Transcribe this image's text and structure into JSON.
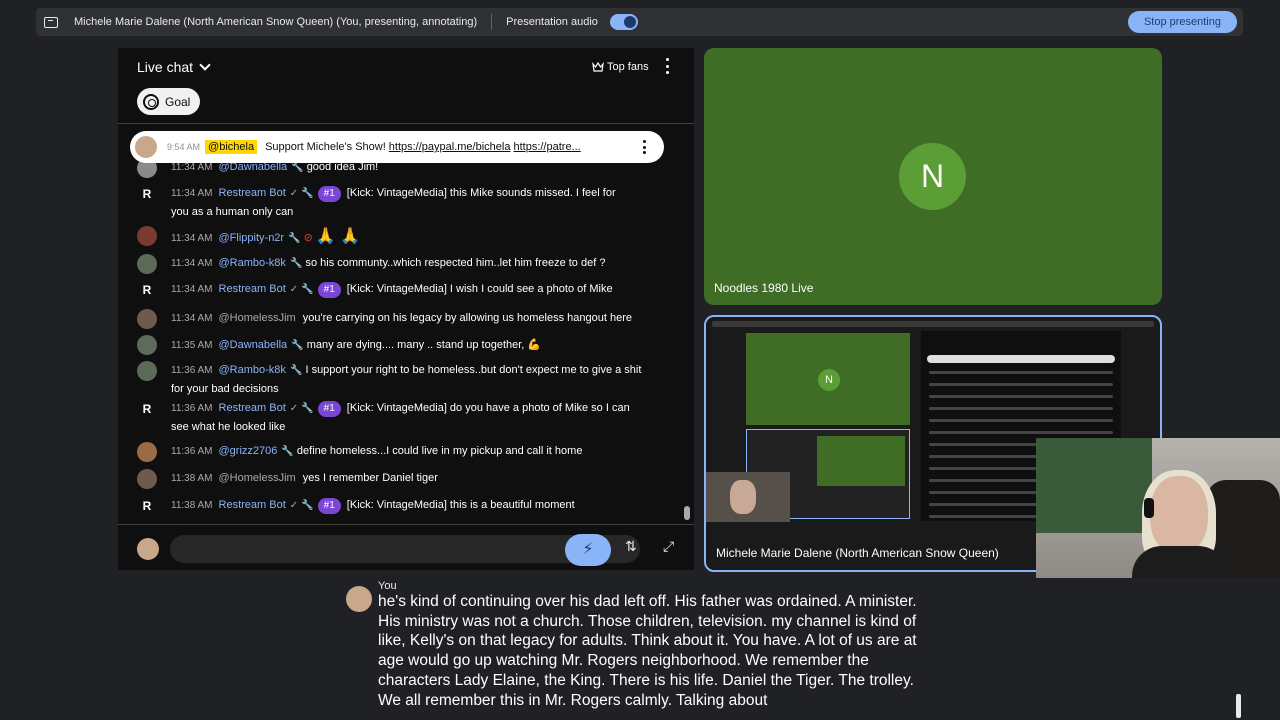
{
  "topbar": {
    "presenting_title": "Michele Marie Dalene (North American Snow Queen) (You, presenting, annotating)",
    "audio_label": "Presentation audio",
    "audio_on": true,
    "stop_label": "Stop presenting"
  },
  "chat": {
    "title": "Live chat",
    "top_fans": "Top fans",
    "goal": "Goal",
    "pinned": {
      "time": "9:54 AM",
      "author": "@bichela",
      "text": "Support Michele's Show!",
      "link1": "https://paypal.me/bichela",
      "link2": "https://patre..."
    },
    "messages": [
      {
        "time": "11:34 AM",
        "author": "@Dawnabella",
        "text": "good idea Jim!"
      },
      {
        "time": "11:34 AM",
        "author": "Restream Bot",
        "badge": "#1",
        "text": "[Kick: VintageMedia] this Mike sounds missed. I feel for",
        "text2": "you as a human only can"
      },
      {
        "time": "11:34 AM",
        "author": "@Flippity-n2r",
        "text": "🙏 🙏"
      },
      {
        "time": "11:34 AM",
        "author": "@Rambo-k8k",
        "text": "so his communty..which respected him..let him freeze to def ?"
      },
      {
        "time": "11:34 AM",
        "author": "Restream Bot",
        "badge": "#1",
        "text": "[Kick: VintageMedia] I wish I could see a photo of Mike"
      },
      {
        "time": "11:34 AM",
        "author": "@HomelessJim",
        "text": "you're carrying on his legacy by allowing us homeless hangout here"
      },
      {
        "time": "11:35 AM",
        "author": "@Dawnabella",
        "text": "many are dying.... many .. stand up together, 💪"
      },
      {
        "time": "11:36 AM",
        "author": "@Rambo-k8k",
        "text": "I support your right to be homeless..but don't expect me to give a shit",
        "text2": "for your bad decisions"
      },
      {
        "time": "11:36 AM",
        "author": "Restream Bot",
        "badge": "#1",
        "text": "[Kick: VintageMedia] do you have a photo of Mike so I can",
        "text2": "see what he looked like"
      },
      {
        "time": "11:36 AM",
        "author": "@grizz2706",
        "text": "define homeless...I could live in my pickup and call it home"
      },
      {
        "time": "11:38 AM",
        "author": "@HomelessJim",
        "text": "yes I remember Daniel tiger"
      },
      {
        "time": "11:38 AM",
        "author": "Restream Bot",
        "badge": "#1",
        "text": "[Kick: VintageMedia] this is a beautiful moment"
      }
    ]
  },
  "tiles": {
    "green_tile_initial": "N",
    "green_tile_name": "Noodles 1980 Live",
    "screen_tile_name": "Michele Marie Dalene (North American Snow Queen)",
    "mini_initial": "N"
  },
  "caption": {
    "speaker": "You",
    "text": "he's kind of continuing over his dad left off. His father was ordained. A minister. His ministry was not a church. Those children, television. my channel is kind of like, Kelly's on that legacy for adults. Think about it. You have. A lot of us are at age would go up watching Mr. Rogers neighborhood. We remember the characters Lady Elaine, the King. There is his life. Daniel the Tiger. The trolley. We all remember this in Mr. Rogers calmly. Talking about"
  },
  "colors": {
    "accent": "#8ab4f8",
    "tile_green": "#3f6d26",
    "badge_purple": "#7b45d6",
    "pinned_tag": "#ffd600"
  },
  "icons": [
    "present-screen-icon",
    "chevron-down-icon",
    "crown-icon",
    "more-vert-icon",
    "goal-icon",
    "wrench-icon",
    "verified-check-icon",
    "lightning-icon",
    "swap-icon",
    "expand-icon"
  ]
}
